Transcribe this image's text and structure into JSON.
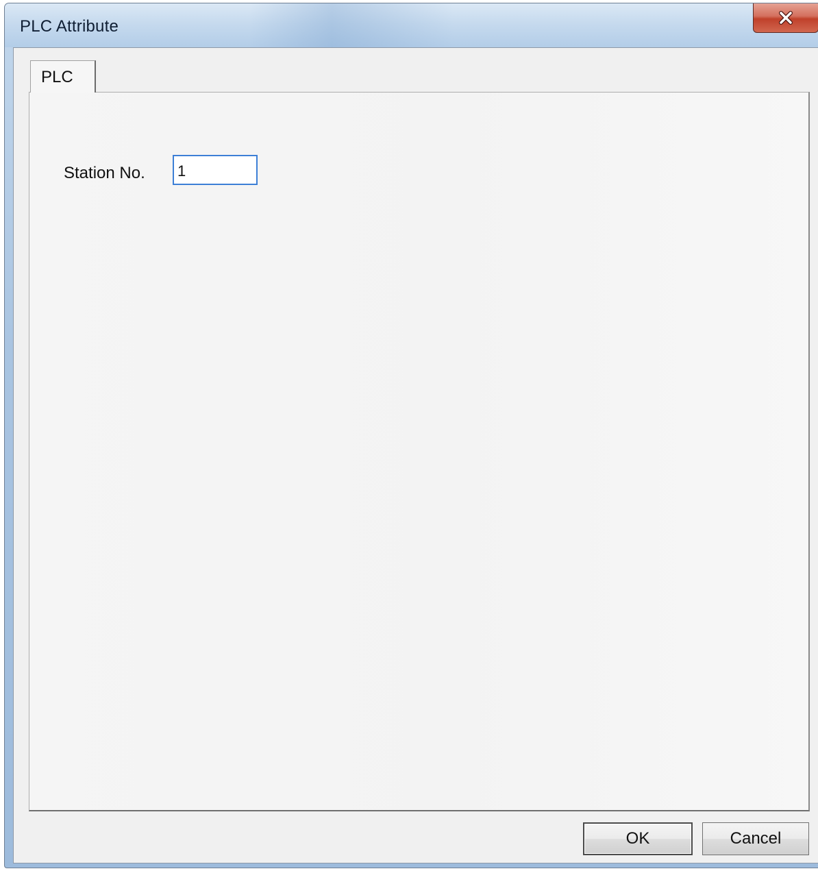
{
  "window": {
    "title": "PLC Attribute",
    "close_icon": "close-icon"
  },
  "tabs": [
    {
      "label": "PLC",
      "selected": true
    }
  ],
  "form": {
    "station_label": "Station No.",
    "station_value": "1"
  },
  "buttons": {
    "ok_label": "OK",
    "cancel_label": "Cancel"
  },
  "colors": {
    "close_button": "#c7463a",
    "focus_border": "#3c7fd6"
  }
}
